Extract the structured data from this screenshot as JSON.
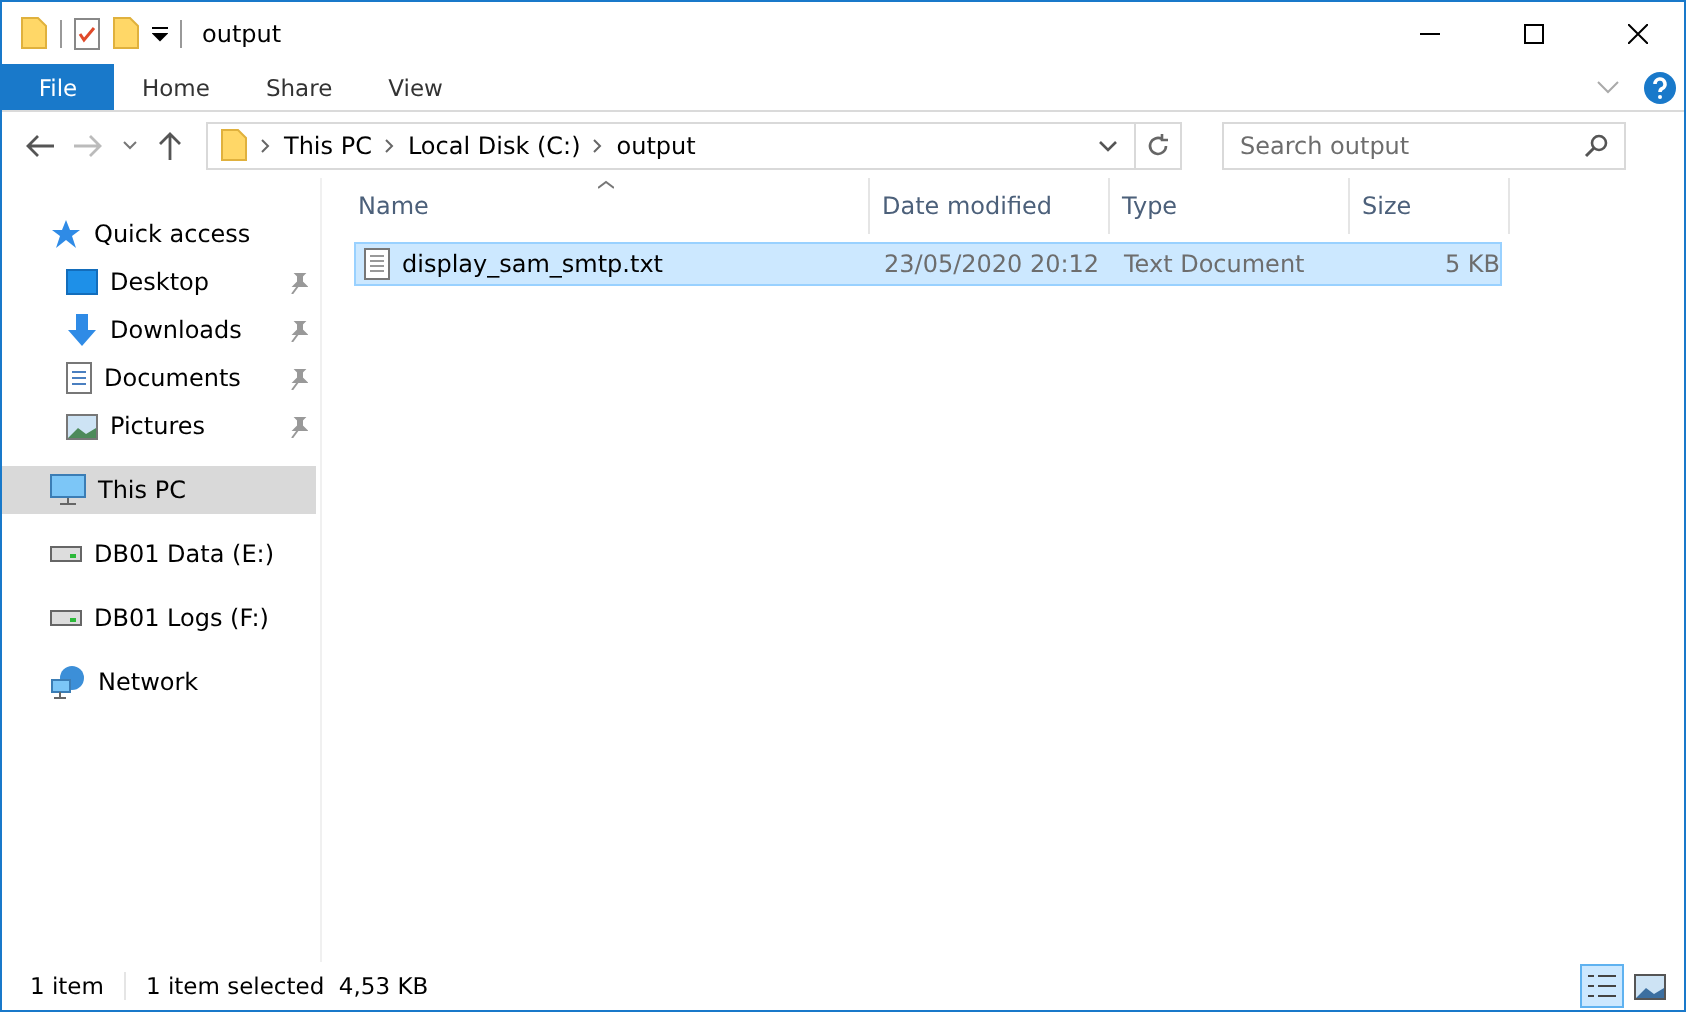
{
  "window": {
    "title": "output"
  },
  "ribbon_tabs": [
    {
      "label": "File",
      "kind": "file"
    },
    {
      "label": "Home",
      "kind": "tab"
    },
    {
      "label": "Share",
      "kind": "tab"
    },
    {
      "label": "View",
      "kind": "tab"
    }
  ],
  "address": {
    "crumbs": [
      "This PC",
      "Local Disk (C:)",
      "output"
    ]
  },
  "search": {
    "placeholder": "Search output"
  },
  "sidebar": {
    "items": [
      {
        "label": "Quick access",
        "kind": "star",
        "pinned": false,
        "selected": false,
        "children": [
          {
            "label": "Desktop",
            "kind": "desktop",
            "pinned": true,
            "selected": false
          },
          {
            "label": "Downloads",
            "kind": "download",
            "pinned": true,
            "selected": false
          },
          {
            "label": "Documents",
            "kind": "documents",
            "pinned": true,
            "selected": false
          },
          {
            "label": "Pictures",
            "kind": "pictures",
            "pinned": true,
            "selected": false
          }
        ]
      },
      {
        "label": "This PC",
        "kind": "pc",
        "pinned": false,
        "selected": true
      },
      {
        "label": "DB01 Data (E:)",
        "kind": "drive",
        "pinned": false,
        "selected": false
      },
      {
        "label": "DB01 Logs (F:)",
        "kind": "drive",
        "pinned": false,
        "selected": false
      },
      {
        "label": "Network",
        "kind": "network",
        "pinned": false,
        "selected": false
      }
    ]
  },
  "table": {
    "columns": [
      "Name",
      "Date modified",
      "Type",
      "Size"
    ],
    "rows": [
      {
        "name": "display_sam_smtp.txt",
        "date": "23/05/2020 20:12",
        "type": "Text Document",
        "size": "5 KB",
        "selected": true
      }
    ]
  },
  "status_bar": {
    "count": "1 item",
    "selection": "1 item selected  4,53 KB",
    "views": [
      {
        "kind": "details",
        "selected": true
      },
      {
        "kind": "large",
        "selected": false
      }
    ]
  }
}
